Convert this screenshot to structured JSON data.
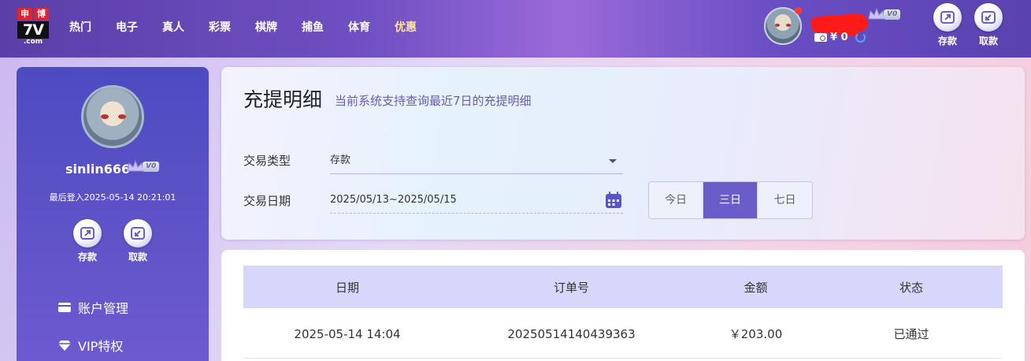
{
  "brand": {
    "cn_chars": [
      "申",
      "博"
    ],
    "logo_text": "7V",
    "logo_sub": ".com"
  },
  "nav": {
    "items": [
      "热门",
      "电子",
      "真人",
      "彩票",
      "棋牌",
      "捕鱼",
      "体育"
    ],
    "promo": "优惠"
  },
  "header": {
    "vip_level": "V0",
    "balance": "¥ 0",
    "deposit_label": "存款",
    "withdraw_label": "取款"
  },
  "sidebar": {
    "username": "sinlin666",
    "vip_level": "V0",
    "last_login": "最后登入2025-05-14 20:21:01",
    "deposit_label": "存款",
    "withdraw_label": "取款",
    "menu": [
      {
        "label": "账户管理",
        "icon": "wallet-card-icon"
      },
      {
        "label": "VIP特权",
        "icon": "diamond-icon"
      }
    ]
  },
  "filter": {
    "title": "充提明细",
    "subtitle": "当前系统支持查询最近7日的充提明细",
    "type_label": "交易类型",
    "type_value": "存款",
    "date_label": "交易日期",
    "date_value": "2025/05/13~2025/05/15",
    "ranges": [
      "今日",
      "三日",
      "七日"
    ],
    "active_range": "三日"
  },
  "table": {
    "columns": [
      "日期",
      "订单号",
      "金额",
      "状态"
    ],
    "rows": [
      [
        "2025-05-14 14:04",
        "20250514140439363",
        "￥203.00",
        "已通过"
      ]
    ]
  },
  "colors": {
    "accent": "#6a5cc9",
    "header_bg": "#d7d7fb",
    "promo": "#ffe98a"
  }
}
